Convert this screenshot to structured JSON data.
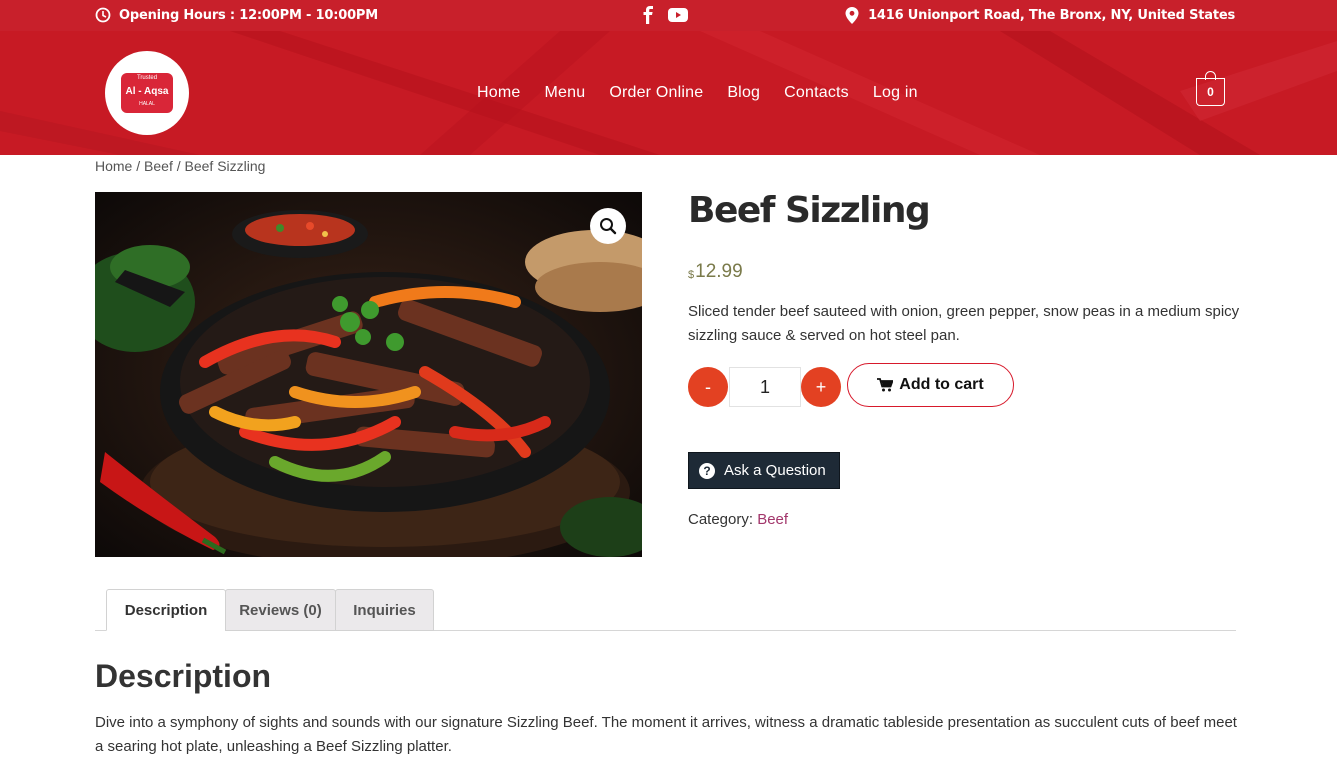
{
  "topbar": {
    "hours": "Opening Hours : 12:00PM - 10:00PM",
    "address": "1416 Unionport Road, The Bronx, NY, United States",
    "social": [
      "facebook-icon",
      "youtube-icon"
    ]
  },
  "logo": {
    "top_text": "Trusted",
    "name": "Al - Aqsa",
    "bottom_text": "HALAL"
  },
  "nav": [
    {
      "label": "Home"
    },
    {
      "label": "Menu"
    },
    {
      "label": "Order Online"
    },
    {
      "label": "Blog"
    },
    {
      "label": "Contacts"
    },
    {
      "label": "Log in"
    }
  ],
  "cart": {
    "count": "0"
  },
  "breadcrumb": {
    "home": "Home",
    "sep": " / ",
    "category": "Beef",
    "current": "Beef Sizzling"
  },
  "product": {
    "title": "Beef Sizzling",
    "currency": "$",
    "price": "12.99",
    "description": "Sliced tender beef sauteed with onion, green pepper, snow peas in a medium spicy sizzling sauce & served on hot steel pan.",
    "quantity": "1",
    "minus_label": "-",
    "plus_label": "+",
    "add_to_cart": "Add to cart",
    "ask_question": "Ask a Question",
    "category_label": "Category: ",
    "category": "Beef"
  },
  "tabs": [
    {
      "label": "Description",
      "active": true
    },
    {
      "label": "Reviews (0)",
      "active": false
    },
    {
      "label": "Inquiries",
      "active": false
    }
  ],
  "description_section": {
    "title": "Description",
    "text": "Dive into a symphony of sights and sounds with our signature Sizzling Beef. The moment it arrives, witness a dramatic tableside presentation as succulent cuts of beef meet a searing hot plate, unleashing a Beef Sizzling platter."
  },
  "colors": {
    "brand_red": "#c8202b",
    "accent_orange": "#e34122",
    "dark_button": "#1e2a36",
    "link": "#a2366b"
  }
}
